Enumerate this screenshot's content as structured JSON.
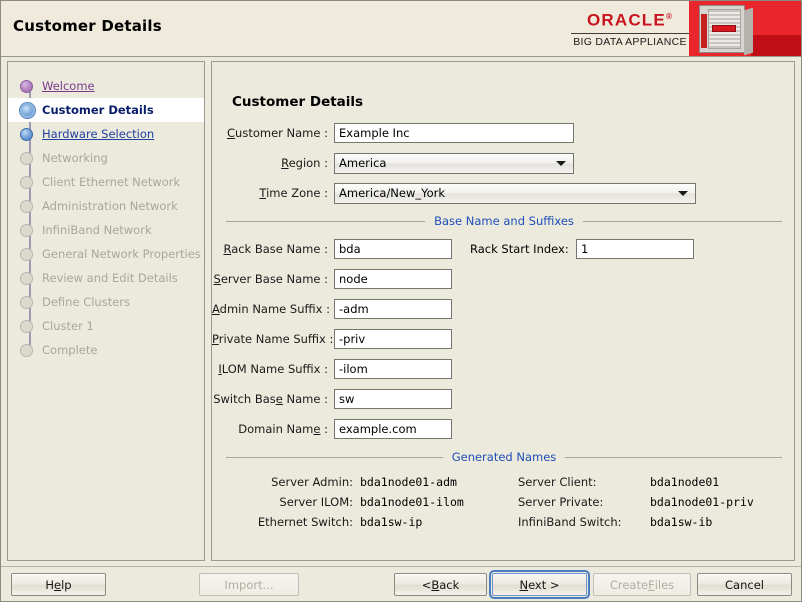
{
  "window": {
    "title": "Customer Details"
  },
  "brand": {
    "name": "ORACLE",
    "trademark": "®",
    "product": "BIG DATA APPLIANCE",
    "accent_red": "#c8141e",
    "banner_red": "#e8262c"
  },
  "sidebar": {
    "items": [
      {
        "label": "Welcome",
        "state": "visited"
      },
      {
        "label": "Customer Details",
        "state": "current"
      },
      {
        "label": "Hardware Selection",
        "state": "link"
      },
      {
        "label": "Networking",
        "state": "disabled"
      },
      {
        "label": "Client Ethernet Network",
        "state": "disabled"
      },
      {
        "label": "Administration Network",
        "state": "disabled"
      },
      {
        "label": "InfiniBand Network",
        "state": "disabled"
      },
      {
        "label": "General Network Properties",
        "state": "disabled"
      },
      {
        "label": "Review and Edit Details",
        "state": "disabled"
      },
      {
        "label": "Define Clusters",
        "state": "disabled"
      },
      {
        "label": "Cluster 1",
        "state": "disabled"
      },
      {
        "label": "Complete",
        "state": "disabled"
      }
    ]
  },
  "main": {
    "heading": "Customer Details",
    "fields": {
      "customer_name": {
        "label_pre": "C",
        "label_post": "ustomer Name :",
        "value": "Example Inc"
      },
      "region": {
        "label_pre": "R",
        "label_post": "egion :",
        "value": "America"
      },
      "time_zone": {
        "label_pre": "T",
        "label_post": "ime Zone :",
        "value": "America/New_York"
      }
    },
    "sections": {
      "base_names": "Base Name and Suffixes",
      "generated": "Generated Names"
    },
    "base_fields": {
      "rack_base_name": {
        "label_pre": "R",
        "label_post": "ack Base Name :",
        "value": "bda"
      },
      "rack_start_index": {
        "label": "Rack Start Index:",
        "value": "1"
      },
      "server_base_name": {
        "label_pre": "S",
        "label_post": "erver Base Name :",
        "value": "node"
      },
      "admin_name_suffix": {
        "label_pre": "A",
        "label_post": "dmin Name Suffix :",
        "value": "-adm"
      },
      "private_name_suffix": {
        "label_pre": "P",
        "label_post": "rivate Name Suffix :",
        "value": "-priv"
      },
      "ilom_name_suffix": {
        "label_pre": "I",
        "label_post": "LOM Name Suffix :",
        "value": "-ilom"
      },
      "switch_base_name": {
        "label_a": "Switch Bas",
        "label_mn": "e",
        "label_b": " Name :",
        "value": "sw"
      },
      "domain_name": {
        "label_a": "Domain Nam",
        "label_mn": "e",
        "label_b": " :",
        "value": "example.com"
      }
    },
    "generated_names": [
      {
        "left_label": "Server Admin:",
        "left_value": "bda1node01-adm",
        "right_label": "Server Client:",
        "right_value": "bda1node01"
      },
      {
        "left_label": "Server ILOM:",
        "left_value": "bda1node01-ilom",
        "right_label": "Server Private:",
        "right_value": "bda1node01-priv"
      },
      {
        "left_label": "Ethernet Switch:",
        "left_value": "bda1sw-ip",
        "right_label": "InfiniBand Switch:",
        "right_value": "bda1sw-ib"
      }
    ]
  },
  "buttons": {
    "help": {
      "pre": "H",
      "mn": "e",
      "post": "lp",
      "state": "enabled"
    },
    "import": {
      "label": "Import...",
      "state": "disabled"
    },
    "back": {
      "pre": "< ",
      "mn": "B",
      "post": "ack",
      "state": "enabled"
    },
    "next": {
      "pre": "",
      "mn": "N",
      "post": "ext >",
      "state": "focused"
    },
    "create": {
      "pre": "Create ",
      "mn": "F",
      "post": "iles",
      "state": "disabled"
    },
    "cancel": {
      "label": "Cancel",
      "state": "enabled"
    }
  }
}
